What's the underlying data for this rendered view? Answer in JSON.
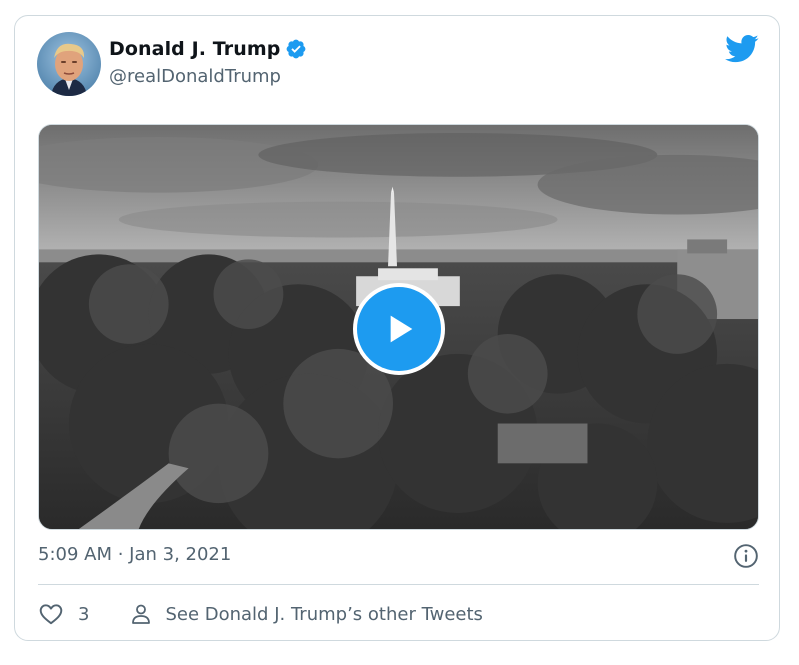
{
  "tweet": {
    "author_name": "Donald J. Trump",
    "author_handle": "@realDonaldTrump",
    "timestamp": "5:09 AM · Jan 3, 2021",
    "like_count": "3",
    "other_tweets_label": "See Donald J. Trump’s other Tweets"
  },
  "icons": {
    "verified": "verified-badge-icon",
    "brand": "twitter-bird-icon",
    "play": "play-icon",
    "info": "info-icon",
    "like": "heart-icon",
    "profile": "person-icon"
  },
  "colors": {
    "accent": "#1d9bf0",
    "text_primary": "#0f1419",
    "text_secondary": "#536471",
    "border": "#cfd9de"
  }
}
